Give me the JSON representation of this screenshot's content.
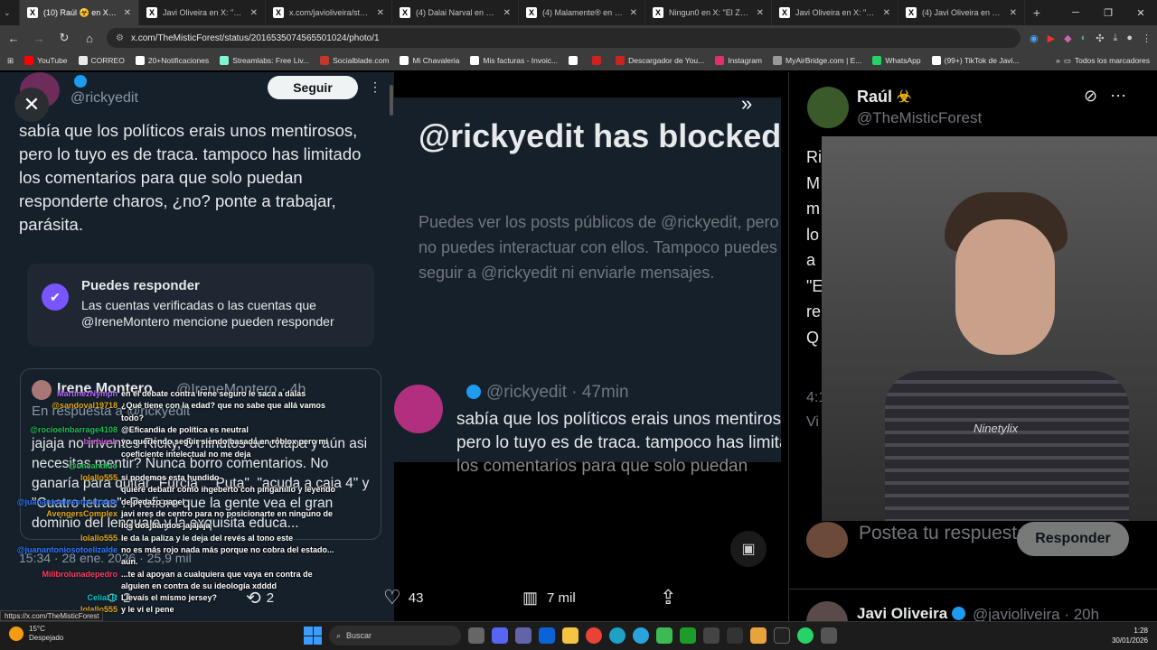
{
  "browser": {
    "tabs": [
      {
        "title": "(10) Raúl ☣️ en X: \"Ricky",
        "active": true,
        "icon": "x-icon"
      },
      {
        "title": "Javi Oliveira en X: \"@Arca",
        "active": false,
        "icon": "x-icon"
      },
      {
        "title": "x.com/javioliveira/status/...",
        "active": false,
        "icon": "x-icon"
      },
      {
        "title": "(4) Dalai Narval en X: \"ode",
        "active": false,
        "icon": "x-icon"
      },
      {
        "title": "(4) Malamente® en X: \"Tr",
        "active": false,
        "icon": "x-icon"
      },
      {
        "title": "Ningun0 en X: \"El Zasca q",
        "active": false,
        "icon": "x-icon"
      },
      {
        "title": "Javi Oliveira en X: \"Si hon",
        "active": false,
        "icon": "x-icon"
      },
      {
        "title": "(4) Javi Oliveira en X: \"@ti",
        "active": false,
        "icon": "x-icon"
      }
    ],
    "url": "x.com/TheMisticForest/status/2016535074565501024/photo/1",
    "bookmarks": [
      {
        "label": "YouTube",
        "color": "#ff0000"
      },
      {
        "label": "CORREO",
        "color": "#e8e8e8"
      },
      {
        "label": "20+Notificaciones",
        "color": "#ffffff"
      },
      {
        "label": "Streamlabs: Free Liv...",
        "color": "#80f5d2"
      },
      {
        "label": "Socialblade.com",
        "color": "#c0392b"
      },
      {
        "label": "Mi Chavaleria",
        "color": "#ffffff"
      },
      {
        "label": "Mis facturas - Invoic...",
        "color": "#ffffff"
      },
      {
        "label": "",
        "color": "#ffffff"
      },
      {
        "label": "",
        "color": "#cc2222"
      },
      {
        "label": "Descargador de You...",
        "color": "#cc2222"
      },
      {
        "label": "Instagram",
        "color": "#e1306c"
      },
      {
        "label": "MyAirBridge.com | E...",
        "color": "#999999"
      },
      {
        "label": "WhatsApp",
        "color": "#25d366"
      },
      {
        "label": "(99+) TikTok de Javi...",
        "color": "#ffffff"
      }
    ],
    "all_bookmarks": "Todos los marcadores"
  },
  "left_tweet": {
    "handle": "@rickyedit",
    "follow_label": "Seguir",
    "text": "sabía que los políticos erais unos mentirosos, pero lo tuyo es de traca. tampoco has limitado los comentarios para que solo puedan responderte charos, ¿no? ponte a trabajar, parásita.",
    "reply_box": {
      "title": "Puedes responder",
      "desc": "Las cuentas verificadas o las cuentas que @IreneMontero mencione pueden responder"
    },
    "quote": {
      "name": "Irene Montero",
      "handle": "@IreneMontero · 4h",
      "sub": "En respuesta a @rickyedit",
      "text": "jajaja no inventes Ricky, 6 minutos de chapa y aún asi necesitas mentir? Nunca borro comentarios. No ganaría para quitar \"Furcia\", \"Puta\", \"acuda a caja 4\" y \"Cuatro letras\". Prefiero que la gente vea el gran dominio del lenguaje y la exquisita educa..."
    },
    "time": "15:34 · 28 ene. 2026 · 25,9 mil"
  },
  "center_panel": {
    "blocked_title": "@rickyedit has blocked you",
    "blocked_desc": "Puedes ver los posts públicos de @rickyedit, pero no puedes interactuar con ellos. Tampoco puedes seguir a @rickyedit ni enviarle mensajes.",
    "post_handle": "@rickyedit · 47min",
    "post_text_1": "sabía que los políticos erais unos mentirosos,",
    "post_text_2": "pero lo tuyo es de traca. tampoco has limitado",
    "post_text_3": "los comentarios para que solo puedan"
  },
  "actions": {
    "replies": "2",
    "reposts": "2",
    "likes": "43",
    "views": "7 mil"
  },
  "right_panel": {
    "name": "Raúl",
    "handle": "@TheMisticForest",
    "letters": [
      "Ri",
      "M",
      "m",
      "lo",
      "a",
      "\"E",
      "re",
      "Q"
    ],
    "peek_time": "4:1",
    "peek_views": "Vi",
    "webcam_shirt_text": "Ninetylix",
    "reply_placeholder": "Postea tu respuesta",
    "reply_button": "Responder",
    "next_name": "Javi Oliveira",
    "next_handle": "@javioliveira · 20h"
  },
  "chat": [
    {
      "user": "MartinezNymph",
      "color": "#b46bff",
      "msg": "en el debate contra Irene seguro le saca a dalas"
    },
    {
      "user": "@sandoval19718",
      "color": "#e3a81b",
      "msg": "¿Qué tiene con la edad? que no sabe que allá vamos"
    },
    {
      "user": "",
      "color": "#e3a81b",
      "msg": "todo?"
    },
    {
      "user": "@rocioelnbarrage4108",
      "color": "#1fbf56",
      "msg": "@Eficandia de política es neutral"
    },
    {
      "user": "barbiesh",
      "color": "#c457d0",
      "msg": "yo queriendo seguir siendo basada en roblox pero mi"
    },
    {
      "user": "",
      "color": "#c457d0",
      "msg": "coeficiente intelectual no me deja"
    },
    {
      "user": "@uncandido",
      "color": "#1fbf56",
      "msg": ""
    },
    {
      "user": "lolallo555",
      "color": "#e3a81b",
      "msg": "si podemos esta hundido"
    },
    {
      "user": "",
      "color": "#9a6bff",
      "msg": "quiere debatir como ingeberto con pinganillo y leyendo"
    },
    {
      "user": "@juanantoniosotoelizalde",
      "color": "#2e78ff",
      "msg": "de pedazo papel"
    },
    {
      "user": "AvengersComplex",
      "color": "#e3a81b",
      "msg": "javi eres de centro para no posicionarte en ninguno de"
    },
    {
      "user": "",
      "color": "#e3a81b",
      "msg": "los dos bandos jajajaja"
    },
    {
      "user": "lolallo555",
      "color": "#e3a81b",
      "msg": "le da la paliza y le deja del revés al tono este"
    },
    {
      "user": "@juanantoniosotoelizalde",
      "color": "#2e78ff",
      "msg": "no es más rojo nada más porque no cobra del estado..."
    },
    {
      "user": "",
      "color": "#2e78ff",
      "msg": "aún."
    },
    {
      "user": "Milibrolunadepedro",
      "color": "#ff3c62",
      "msg": "...te al apoyan a cualquiera que vaya en contra de"
    },
    {
      "user": "",
      "color": "#ff3c62",
      "msg": "alguien en contra de su ideología xdddd"
    },
    {
      "user": "CeliaLR",
      "color": "#00c7c7",
      "msg": "Llevaís el mismo jersey?"
    },
    {
      "user": "lolallo555",
      "color": "#e3a81b",
      "msg": "y le vi el pene"
    }
  ],
  "status_link": "https://x.com/TheMisticForest",
  "taskbar": {
    "temp": "15°C",
    "weather": "Despejado",
    "search": "Buscar",
    "time": "1:28",
    "date": "30/01/2026"
  }
}
